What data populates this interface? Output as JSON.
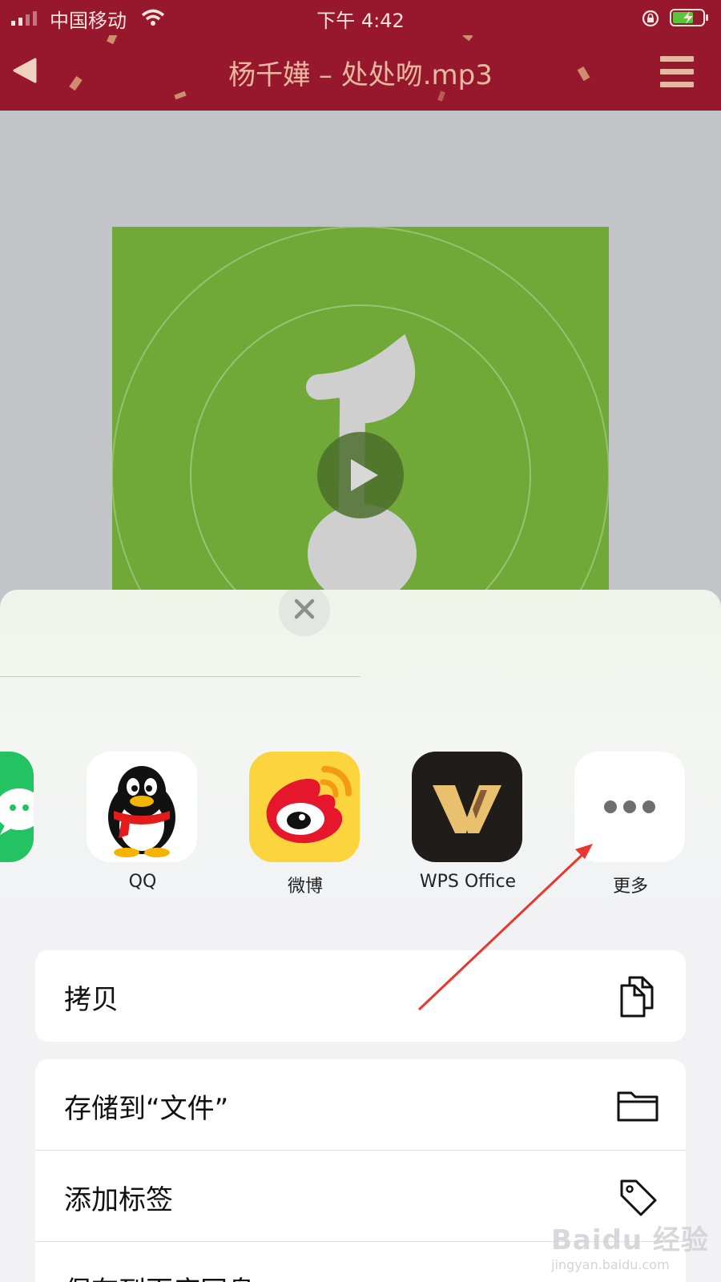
{
  "status_bar": {
    "carrier": "中国移动",
    "time": "下午 4:42"
  },
  "nav": {
    "title": "杨千嬅 – 处处吻.mp3"
  },
  "share_sheet": {
    "apps": [
      {
        "name": "QQ",
        "icon": "qq-penguin-icon"
      },
      {
        "name": "微博",
        "icon": "weibo-icon"
      },
      {
        "name": "WPS Office",
        "icon": "wps-office-icon"
      },
      {
        "name": "更多",
        "icon": "more-dots-icon"
      }
    ],
    "actions": [
      {
        "label": "拷贝",
        "icon": "copy-icon"
      },
      {
        "label": "存储到“文件”",
        "icon": "folder-icon"
      },
      {
        "label": "添加标签",
        "icon": "tag-icon"
      },
      {
        "label": "保存到百度网盘",
        "icon": "baidu-netdisk-icon"
      }
    ]
  },
  "watermark": {
    "line1": "Baidu 经验",
    "line2": "jingyan.baidu.com"
  },
  "colors": {
    "brand_red": "#97182d",
    "album_green": "#70a938",
    "annotation_arrow": "#e8382e"
  }
}
